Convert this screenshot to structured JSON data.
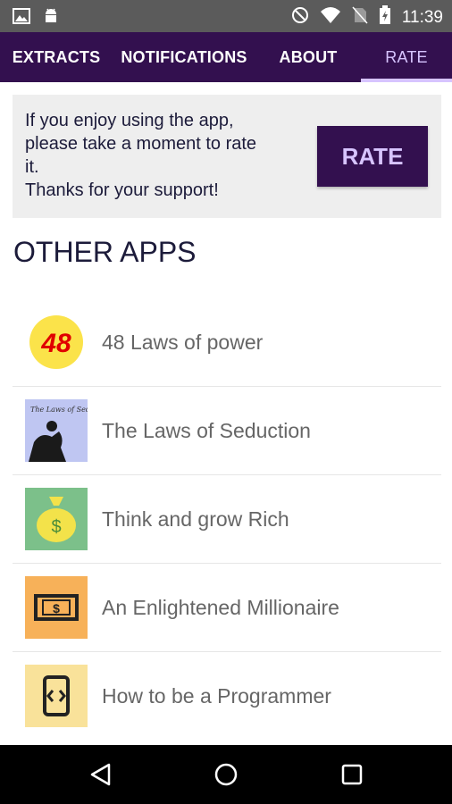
{
  "status_bar": {
    "time": "11:39",
    "left_icons": [
      "image-icon",
      "android-icon"
    ],
    "right_icons": [
      "do-not-disturb-icon",
      "wifi-icon",
      "no-sim-icon",
      "battery-charging-icon"
    ]
  },
  "tabs": [
    {
      "label": "EXTRACTS",
      "selected": false
    },
    {
      "label": "NOTIFICATIONS",
      "selected": false
    },
    {
      "label": "ABOUT",
      "selected": false
    },
    {
      "label": "RATE",
      "selected": true
    }
  ],
  "rate_card": {
    "line1": "If you enjoy using the app,",
    "line2": "please take a moment to rate",
    "line3": "it.",
    "line4": "Thanks for your support!",
    "button_label": "RATE"
  },
  "other_apps": {
    "title": "OTHER APPS",
    "items": [
      {
        "label": "48 Laws of power",
        "icon": "48-laws-icon",
        "icon_text": "48"
      },
      {
        "label": "The Laws of Seduction",
        "icon": "laws-of-seduction-icon",
        "icon_text": "The Laws of Seduction"
      },
      {
        "label": "Think and grow Rich",
        "icon": "money-bag-icon",
        "icon_text": "$"
      },
      {
        "label": "An Enlightened Millionaire",
        "icon": "dollar-bill-icon",
        "icon_text": "$"
      },
      {
        "label": "How to be a Programmer",
        "icon": "code-phone-icon"
      }
    ]
  },
  "colors": {
    "primary": "#33104f",
    "accent": "#d7c4ff",
    "card_bg": "#eeeeee",
    "status_bar": "#5b5b5b"
  },
  "nav_bar": {
    "buttons": [
      "back-icon",
      "home-icon",
      "recents-icon"
    ]
  }
}
